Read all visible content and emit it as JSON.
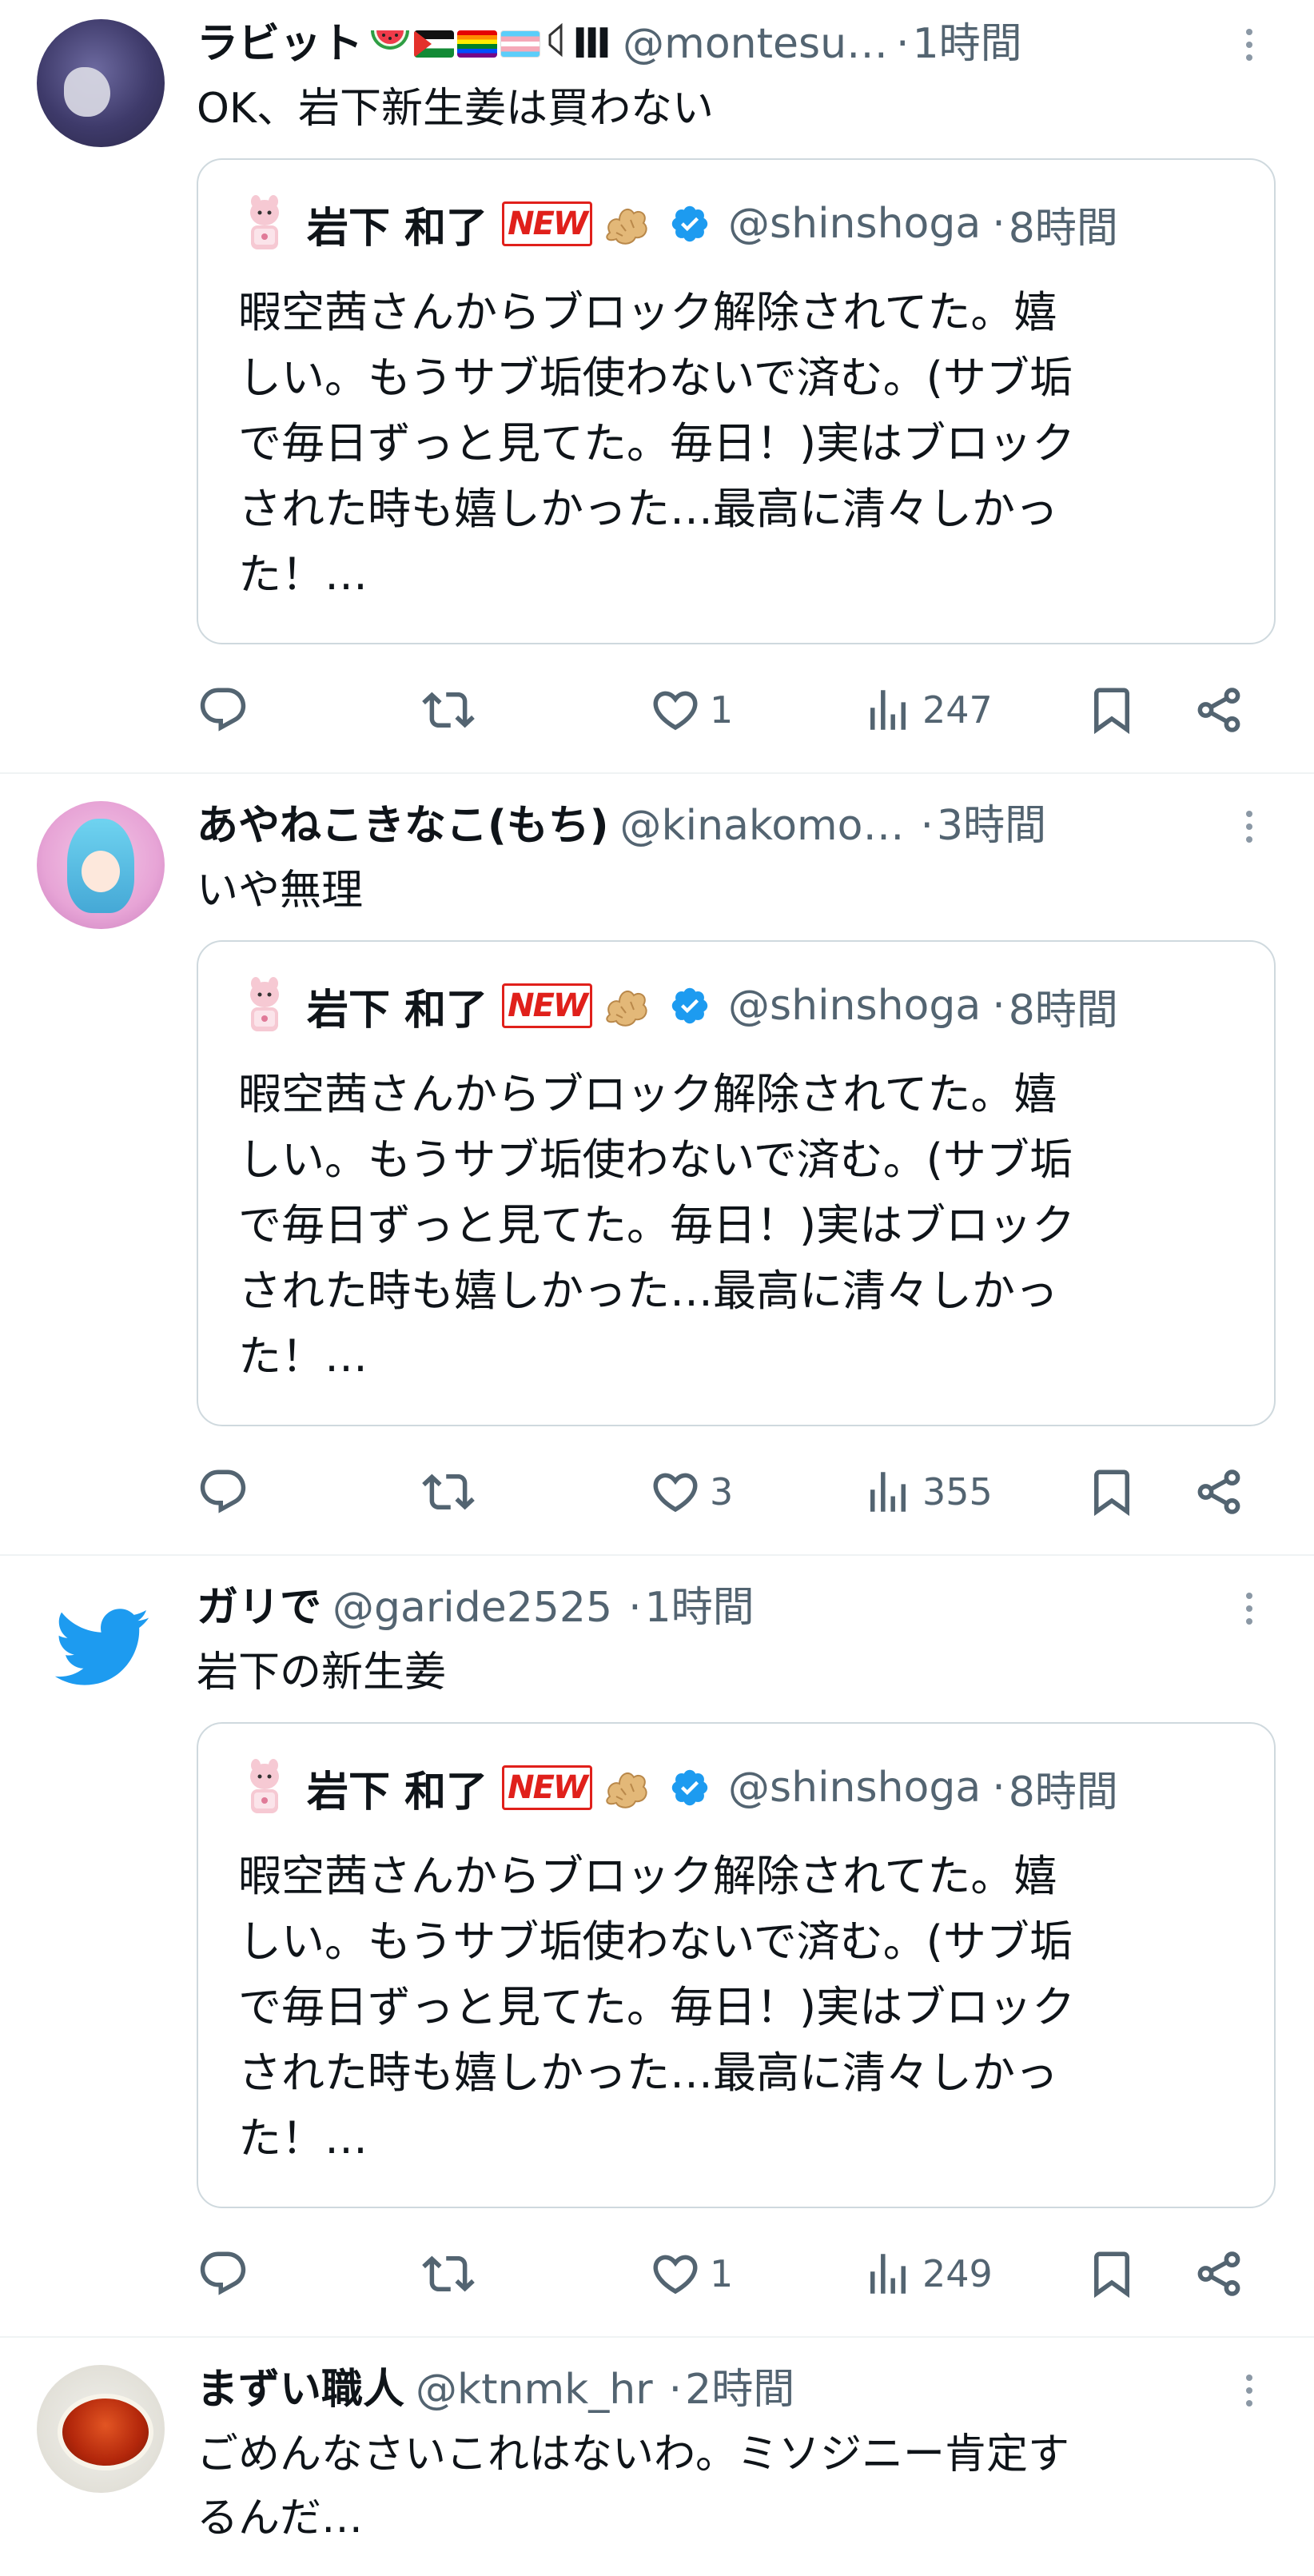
{
  "quote": {
    "name": "岩下 和了",
    "badge": "NEW",
    "handle": "@shinshoga",
    "separator": "·",
    "time": "8時間",
    "text": "暇空茜さんからブロック解除されてた。嬉\nしい。もうサブ垢使わないで済む。(サブ垢\nで毎日ずっと見てた。毎日！)実はブロック\nされた時も嬉しかった…最高に清々しかっ\nた！…"
  },
  "tweets": [
    {
      "name": "ラビット",
      "emoji_suffix": "Ⅲ",
      "handle": "@montesu…",
      "separator": "·",
      "time": "1時間",
      "text": "OK、岩下新生姜は買わない",
      "likes": "1",
      "views": "247"
    },
    {
      "name": "あやねこきなこ(もち)",
      "handle": "@kinakomo…",
      "separator": "·",
      "time": "3時間",
      "text": "いや無理",
      "likes": "3",
      "views": "355"
    },
    {
      "name": "ガリで",
      "handle": "@garide2525",
      "separator": "·",
      "time": "1時間",
      "text": "岩下の新生姜",
      "likes": "1",
      "views": "249"
    },
    {
      "name": "まずい職人",
      "handle": "@ktnmk_hr",
      "separator": "·",
      "time": "2時間",
      "text": "ごめんなさいこれはないわ。ミソジニー肯定す\nるんだ…"
    }
  ],
  "icons": {
    "avatar_default": "twitter-bird-icon",
    "reply": "reply-icon",
    "retweet": "retweet-icon",
    "like": "heart-icon",
    "views": "views-icon",
    "bookmark": "bookmark-icon",
    "share": "share-icon",
    "more": "more-icon",
    "verified": "verified-badge-icon"
  },
  "colors": {
    "text": "#0f1419",
    "secondary": "#536471",
    "border": "#cfd9de",
    "verified": "#1d9bf0",
    "twitter_blue": "#1d9bf0",
    "new_badge": "#e0201b"
  }
}
